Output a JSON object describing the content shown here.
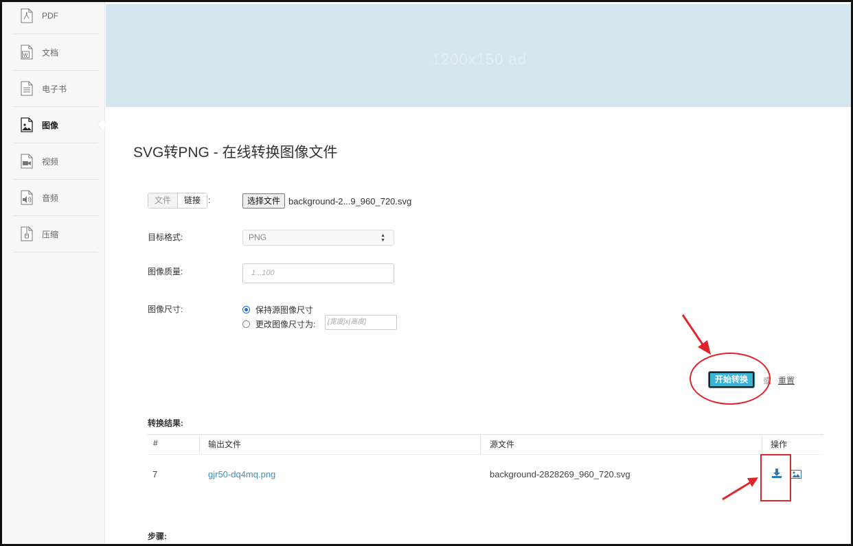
{
  "sidebar": {
    "items": [
      {
        "label": "PDF",
        "icon": "pdf-file-icon"
      },
      {
        "label": "文档",
        "icon": "word-file-icon"
      },
      {
        "label": "电子书",
        "icon": "ebook-file-icon"
      },
      {
        "label": "图像",
        "icon": "image-file-icon",
        "active": true
      },
      {
        "label": "视频",
        "icon": "video-file-icon"
      },
      {
        "label": "音频",
        "icon": "audio-file-icon"
      },
      {
        "label": "压缩",
        "icon": "archive-file-icon"
      }
    ]
  },
  "banner": {
    "placeholder": "1200x150 ad"
  },
  "page": {
    "title": "SVG转PNG - 在线转换图像文件"
  },
  "form": {
    "source_tabs": {
      "file": "文件",
      "link": "链接"
    },
    "colon": ":",
    "choose_file": "选择文件",
    "file_name": "background-2...9_960_720.svg",
    "target_label": "目标格式:",
    "target_value": "PNG",
    "quality_label": "图像质量:",
    "quality_placeholder": "1...100",
    "size_label": "图像尺寸:",
    "size_keep": "保持源图像尺寸",
    "size_change": "更改图像尺寸为:",
    "size_placeholder": "[宽度]x[高度]",
    "start_button": "开始转换",
    "or": "或",
    "reset": "重置"
  },
  "results": {
    "label": "转换结果:",
    "columns": [
      "#",
      "输出文件",
      "源文件",
      "操作"
    ],
    "rows": [
      {
        "index": "7",
        "output": "gjr50-dq4mq.png",
        "source": "background-2828269_960_720.svg"
      }
    ]
  },
  "steps": {
    "label": "步骤:"
  },
  "colors": {
    "accent": "#3cb4d8",
    "link": "#3d8fc4",
    "annotation": "#e0242a",
    "banner": "#d6e6ef"
  }
}
